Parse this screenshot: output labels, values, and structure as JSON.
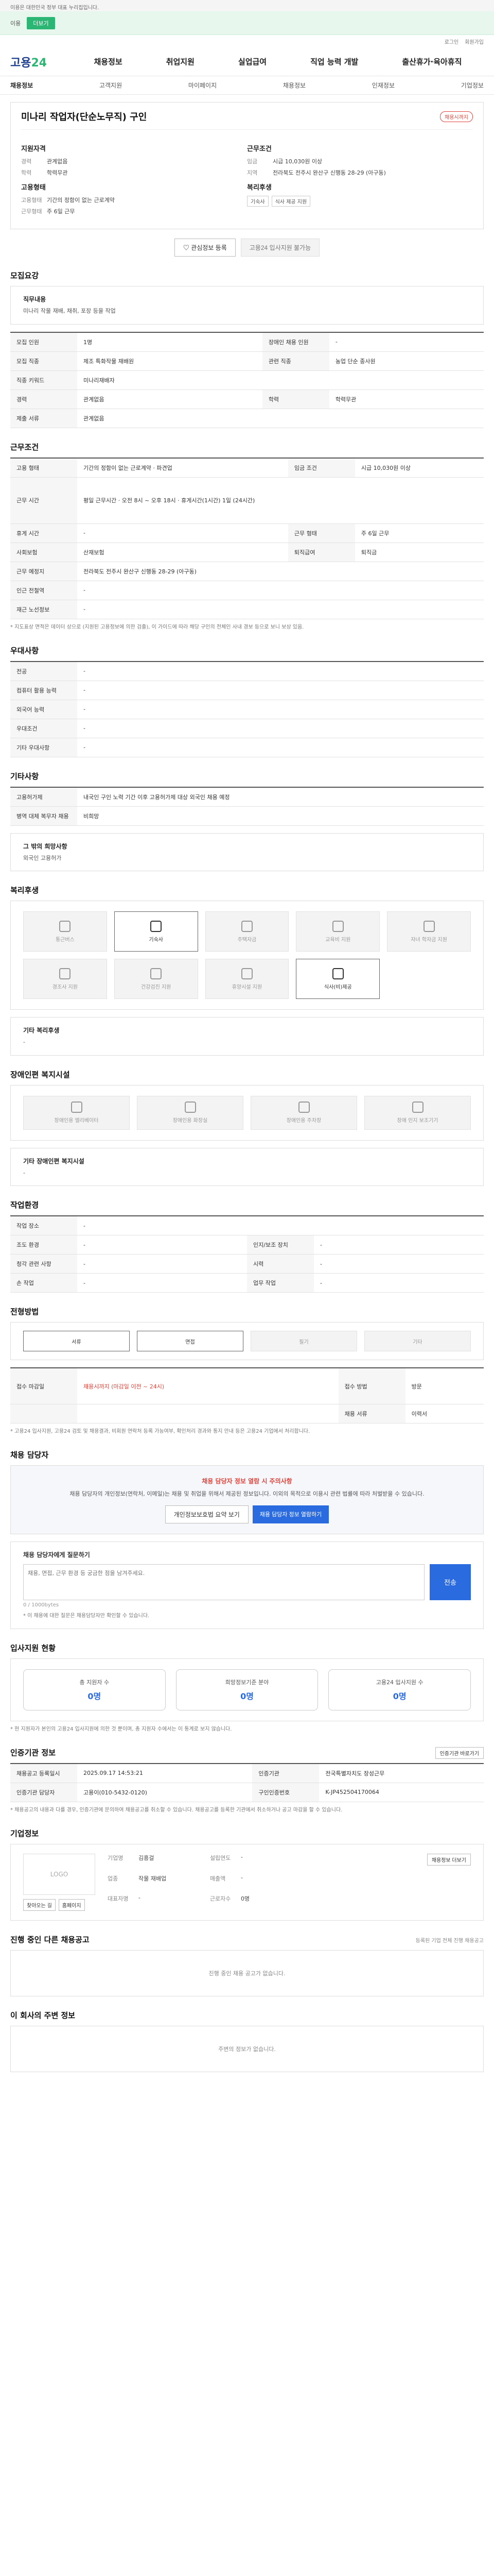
{
  "topbar": {
    "notice": "이용은 대한민국 정부 대표 누리집입니다."
  },
  "greenbar": {
    "hint": "이용",
    "button": "더보기"
  },
  "util": {
    "login": "로그인",
    "join": "회원가입"
  },
  "header": {
    "logo_main": "고용",
    "logo_accent": "24",
    "gnb": [
      "채용정보",
      "취업지원",
      "실업급여",
      "직업 능력 개발",
      "출산휴가·육아휴직"
    ]
  },
  "subnav": [
    "채용정보",
    "고객지원",
    "마이페이지",
    "채용정보",
    "인재정보",
    "기업정보"
  ],
  "job": {
    "title": "미나리 작업자(단순노무직) 구인",
    "badge": "채용시까지",
    "recruit_heading": "지원자격",
    "recruit": [
      {
        "k": "경력",
        "v": "관계없음"
      },
      {
        "k": "학력",
        "v": "학력무관"
      }
    ],
    "type_heading": "고용형태",
    "type": [
      {
        "k": "고용형태",
        "v": "기간의 정함이 없는 근로계약"
      },
      {
        "k": "근무형태",
        "v": "주 6일 근무"
      }
    ],
    "cond_heading": "근무조건",
    "cond": [
      {
        "k": "임금",
        "v": "시급 10,030원 이상"
      },
      {
        "k": "지역",
        "v": "전라북도 전주시 완산구 신행동 28-29 (아구동)"
      }
    ],
    "welfare_heading": "복리후생",
    "welfare_tags": [
      "기숙사",
      "식사 제공 지원"
    ],
    "btn_interest": "관심정보 등록",
    "btn_apply": "고용24 입사지원 불가능"
  },
  "sections": {
    "recruit_title": "모집요강",
    "duty_label": "직무내용",
    "duty_text": "미나리 작물 재배, 채취, 포장 등을 작업",
    "recruit_rows": [
      [
        "모집 인원",
        "1명",
        "장애인 채용 인원",
        "-"
      ],
      [
        "모집 직종",
        "제조 특화작물 재배원",
        "관련 직종",
        "농업 단순 종사원"
      ],
      [
        "직종 키워드",
        "미나리재배자",
        "",
        ""
      ],
      [
        "경력",
        "관계없음",
        "학력",
        "학력무관"
      ],
      [
        "제출 서류",
        "관계없음",
        "",
        ""
      ]
    ],
    "cond_title": "근무조건",
    "cond_rows": [
      [
        "고용 형태",
        "기간의 정함이 없는 근로계약 · 파견업",
        "임금 조건",
        "시급 10,030원 이상"
      ],
      [
        "근무 시간",
        "평일 근무시간 · 오전 8시 ~ 오후 18시 · 휴게시간(1시간) 1일 (24시간)",
        "",
        ""
      ],
      [
        "휴게 시간",
        "-",
        "근무 형태",
        "주 6일 근무"
      ],
      [
        "사회보험",
        "산재보험",
        "퇴직급여",
        "퇴직금"
      ],
      [
        "근무 예정지",
        "전라북도 전주시 완산구 신행동 28-29 (아구동)",
        "",
        ""
      ],
      [
        "인근 전철역",
        "-",
        "",
        ""
      ],
      [
        "재근 노선정보",
        "-",
        "",
        ""
      ]
    ],
    "cond_note": "* 지도표상 면적은 데이터 상으로 (지원된 고용정보에 의한 검출), 이 가이드에 따라 해당 구인의 전체인 사내 경보 등으로 보니 보상 있음.",
    "pref_title": "우대사항",
    "pref_rows": [
      [
        "전공",
        "-"
      ],
      [
        "컴퓨터 활용 능력",
        "-"
      ],
      [
        "외국어 능력",
        "-"
      ],
      [
        "우대조건",
        "-"
      ],
      [
        "기타 우대사항",
        "-"
      ]
    ],
    "etc_title": "기타사항",
    "etc_rows": [
      [
        "고용허가제",
        "내국인 구인 노력 기간 이후 고용허가제 대상 외국인 채용 예정"
      ],
      [
        "병역 대체 복무자 채용",
        "비희망"
      ]
    ],
    "etc_box_label": "그 밖의 희망사항",
    "etc_box_text": "외국인 고용허가",
    "welfare_title": "복리후생",
    "welfare_cards": [
      {
        "label": "통근버스",
        "on": false
      },
      {
        "label": "기숙사",
        "on": true
      },
      {
        "label": "주택자금",
        "on": false
      },
      {
        "label": "교육비 지원",
        "on": false
      },
      {
        "label": "자녀 학자금 지원",
        "on": false
      },
      {
        "label": "경조사 지원",
        "on": false
      },
      {
        "label": "건강검진 지원",
        "on": false
      },
      {
        "label": "휴양시설 지원",
        "on": false
      },
      {
        "label": "식사(비)제공",
        "on": true
      },
      {
        "label": "",
        "on": false
      }
    ],
    "welfare_etc_label": "기타 복리후생",
    "welfare_etc_text": "-",
    "disab_title": "장애인편 복지시설",
    "disab_cards": [
      "장애인용 엘리베이터",
      "장애인용 화장실",
      "장애인용 주차장",
      "장애 인지 보조기기"
    ],
    "disab_etc_label": "기타 장애인편 복지시설",
    "disab_etc_text": "-",
    "env_title": "작업환경",
    "env_rows": [
      [
        "작업 장소",
        "-",
        "",
        ""
      ],
      [
        "조도 환경",
        "-",
        "인지/보조 장치",
        "-"
      ],
      [
        "청각 관련 사항",
        "-",
        "시력",
        "-"
      ],
      [
        "손 작업",
        "-",
        "업무 작업",
        "-"
      ]
    ],
    "method_title": "전형방법",
    "method_cards": [
      "서류",
      "면접",
      "필기",
      "기타"
    ],
    "apply_rows": [
      [
        "접수 마감일",
        "채용시까지 (마감일 이전 ~ 24시)",
        "접수 방법",
        "방문"
      ],
      [
        "",
        "",
        "채용 서류",
        "이력서"
      ]
    ],
    "apply_note": "* 고용24 입사지원, 고용24 검토 및 채용결과, 비회원 연락처 등록 가능여부, 확인처리 경과와 통지 안내 등은 고용24 기업에서 처리합니다.",
    "manager_title": "채용 담당자",
    "manager_warn": "채용 담당자 정보 열람 시 주의사항",
    "manager_text": "채용 담당자의 개인정보(연락처, 이메일)는 채용 및 취업을 위해서 제공된 정보입니다. 이외의 목적으로 이용시 관련 법률에 따라 처벌받을 수 있습니다.",
    "manager_btn1": "개인정보보호법 요약 보기",
    "manager_btn2": "채용 담당자 정보 열람하기",
    "question_label": "채용 담당자에게 질문하기",
    "question_placeholder": "채용, 면접, 근무 환경 등 궁금한 점을 남겨주세요.",
    "question_count": "0 / 1000bytes",
    "question_btn": "전송",
    "question_note": "* 이 채용에 대한 질문은 채용담당자만 확인할 수 있습니다.",
    "stats_title": "입사지원 현황",
    "stats": [
      {
        "label": "총 지원자 수",
        "value": "0명"
      },
      {
        "label": "희망정보기준 분야",
        "value": "0명"
      },
      {
        "label": "고용24 입사지원 수",
        "value": "0명"
      }
    ],
    "stats_note": "* 현 지원자가 본인의 고용24 입사지원에 의한 것 뿐이며, 총 지원자 수에서는 이 통계로 보지 않습니다.",
    "info_title": "인증기관 정보",
    "info_btn": "인증기관 바로가기",
    "info_rows": [
      [
        "채용공고 등록일시",
        "2025.09.17 14:53:21",
        "인증기관",
        "전국특별자치도 장성근무"
      ],
      [
        "인증기관 담당자",
        "고용이(010-5432-0120)",
        "구인인증번호",
        "K-JP452504170064"
      ]
    ],
    "info_note": "* 채용공고의 내용과 다를 경우, 인증기관에 문의하여 채용공고를 취소할 수 있습니다. 채용공고를 등록한 기관에서 취소하거나 공고 마감을 할 수 있습니다.",
    "company_title": "기업정보",
    "company_logo": "LOGO",
    "company_btn": "채용정보 더보기",
    "company_info": [
      [
        "기업명",
        "김흥걸",
        "설립연도",
        "-"
      ],
      [
        "업종",
        "작물 재배업",
        "매출액",
        "-"
      ],
      [
        "대표자명",
        "-",
        "근로자수",
        "0명"
      ]
    ],
    "company_btn_map": "찾아오는 길",
    "company_btn_home": "홈페이지",
    "other_title": "진행 중인 다른 채용공고",
    "other_note": "등록된 기업 전체 진행 채용공고",
    "other_empty": "진행 중인 채용 공고가 없습니다.",
    "nearby_title": "이 회사의 주변 정보",
    "nearby_empty": "주변의 정보가 없습니다."
  }
}
